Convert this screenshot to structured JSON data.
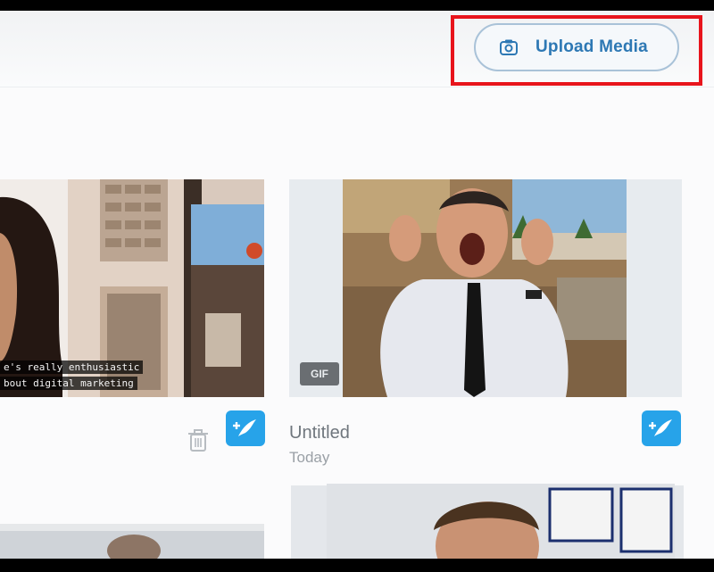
{
  "toolbar": {
    "upload_label": "Upload Media",
    "upload_icon": "camera-icon"
  },
  "cards": [
    {
      "kind": "video",
      "subtitle_lines": [
        "e's really enthusiastic",
        "bout digital marketing"
      ],
      "actions": [
        "trash-icon",
        "tweet-compose-icon"
      ]
    },
    {
      "kind": "gif",
      "badge": "GIF",
      "title": "Untitled",
      "date": "Today",
      "actions": [
        "tweet-compose-icon"
      ]
    }
  ],
  "colors": {
    "accent": "#27a3e9",
    "upload_text": "#2d78b4",
    "highlight": "#e8141c"
  }
}
